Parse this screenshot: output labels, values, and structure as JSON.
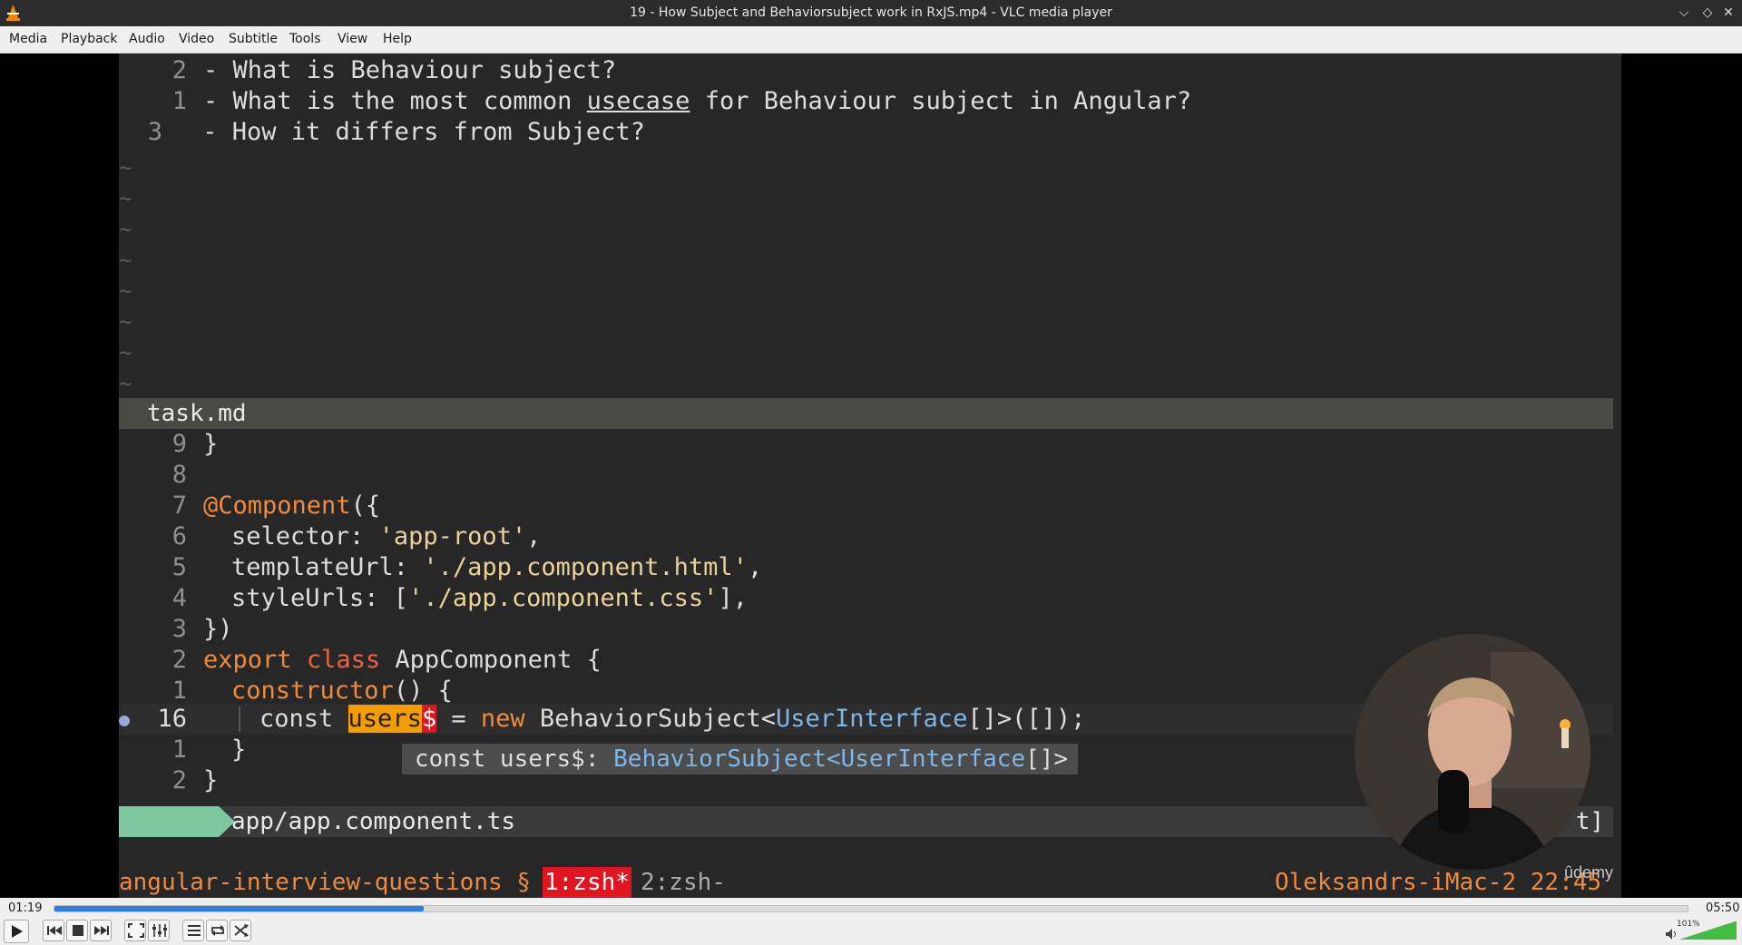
{
  "window": {
    "title": "19 - How Subject and Behaviorsubject work in RxJS.mp4 - VLC media player",
    "controls": {
      "minimize": "⌵",
      "maximize": "◇",
      "close": "✕"
    }
  },
  "menu": [
    "Media",
    "Playback",
    "Audio",
    "Video",
    "Subtitle",
    "Tools",
    "View",
    "Help"
  ],
  "editor": {
    "top_pane": {
      "lines": [
        {
          "num": "2",
          "text": "- What is Behaviour subject?"
        },
        {
          "num": "1",
          "text_before": "- What is the most common ",
          "underlined": "usecase",
          "text_after": " for Behaviour subject in Angular?"
        },
        {
          "num": "3",
          "text": " - How it differs from Subject?"
        }
      ],
      "tilde": "~"
    },
    "split_filename": "task.md",
    "bottom_pane": {
      "l1": {
        "num": "9",
        "text": "}"
      },
      "l2": {
        "num": "8",
        "text": ""
      },
      "l3": {
        "num": "7",
        "decorator": "@Component",
        "rest": "({"
      },
      "l4": {
        "num": "6",
        "key": "selector: ",
        "val": "'app-root'",
        "tail": ","
      },
      "l5": {
        "num": "5",
        "key": "templateUrl: ",
        "val": "'./app.component.html'",
        "tail": ","
      },
      "l6": {
        "num": "4",
        "key": "styleUrls: [",
        "val": "'./app.component.css'",
        "tail": "],"
      },
      "l7": {
        "num": "3",
        "text": "})"
      },
      "l8": {
        "num": "2",
        "kw1": "export",
        "kw2": "class",
        "name": " AppComponent {"
      },
      "l9": {
        "num": "1",
        "kw": "constructor",
        "rest": "() {"
      },
      "l10": {
        "num": "16",
        "marker": "●",
        "const": "const ",
        "hl_user": "users",
        "hl_dollar": "$",
        "mid": " = ",
        "new": "new",
        "cls": " BehaviorSubject<",
        "iface": "UserInterface",
        "end": "[]>([]);"
      },
      "l11": {
        "num": "1",
        "text": "}"
      },
      "l12": {
        "num": "2",
        "text": "}"
      }
    },
    "popup": {
      "prefix": "const users$: ",
      "type1": "BehaviorSubject<",
      "type2": "UserInterface",
      "end": "[]>"
    },
    "status": {
      "path": "app/app.component.ts",
      "right": "t]"
    },
    "tmux": {
      "session": "angular-interview-questions §",
      "window1": "1:zsh*",
      "window2": "2:zsh-",
      "host": "Oleksandrs-iMac-2 22:45"
    },
    "watermark": "ûdemy"
  },
  "player": {
    "elapsed": "01:19",
    "total": "05:50",
    "progress_fraction": 0.226,
    "volume_label": "101%",
    "volume_fraction": 1.0,
    "accent": "#2e7fd9"
  },
  "icons": [
    "vlc-cone-icon",
    "play-icon",
    "previous-icon",
    "stop-icon",
    "next-icon",
    "fullscreen-icon",
    "extended-settings-icon",
    "playlist-icon",
    "loop-icon",
    "shuffle-icon",
    "speaker-icon"
  ]
}
